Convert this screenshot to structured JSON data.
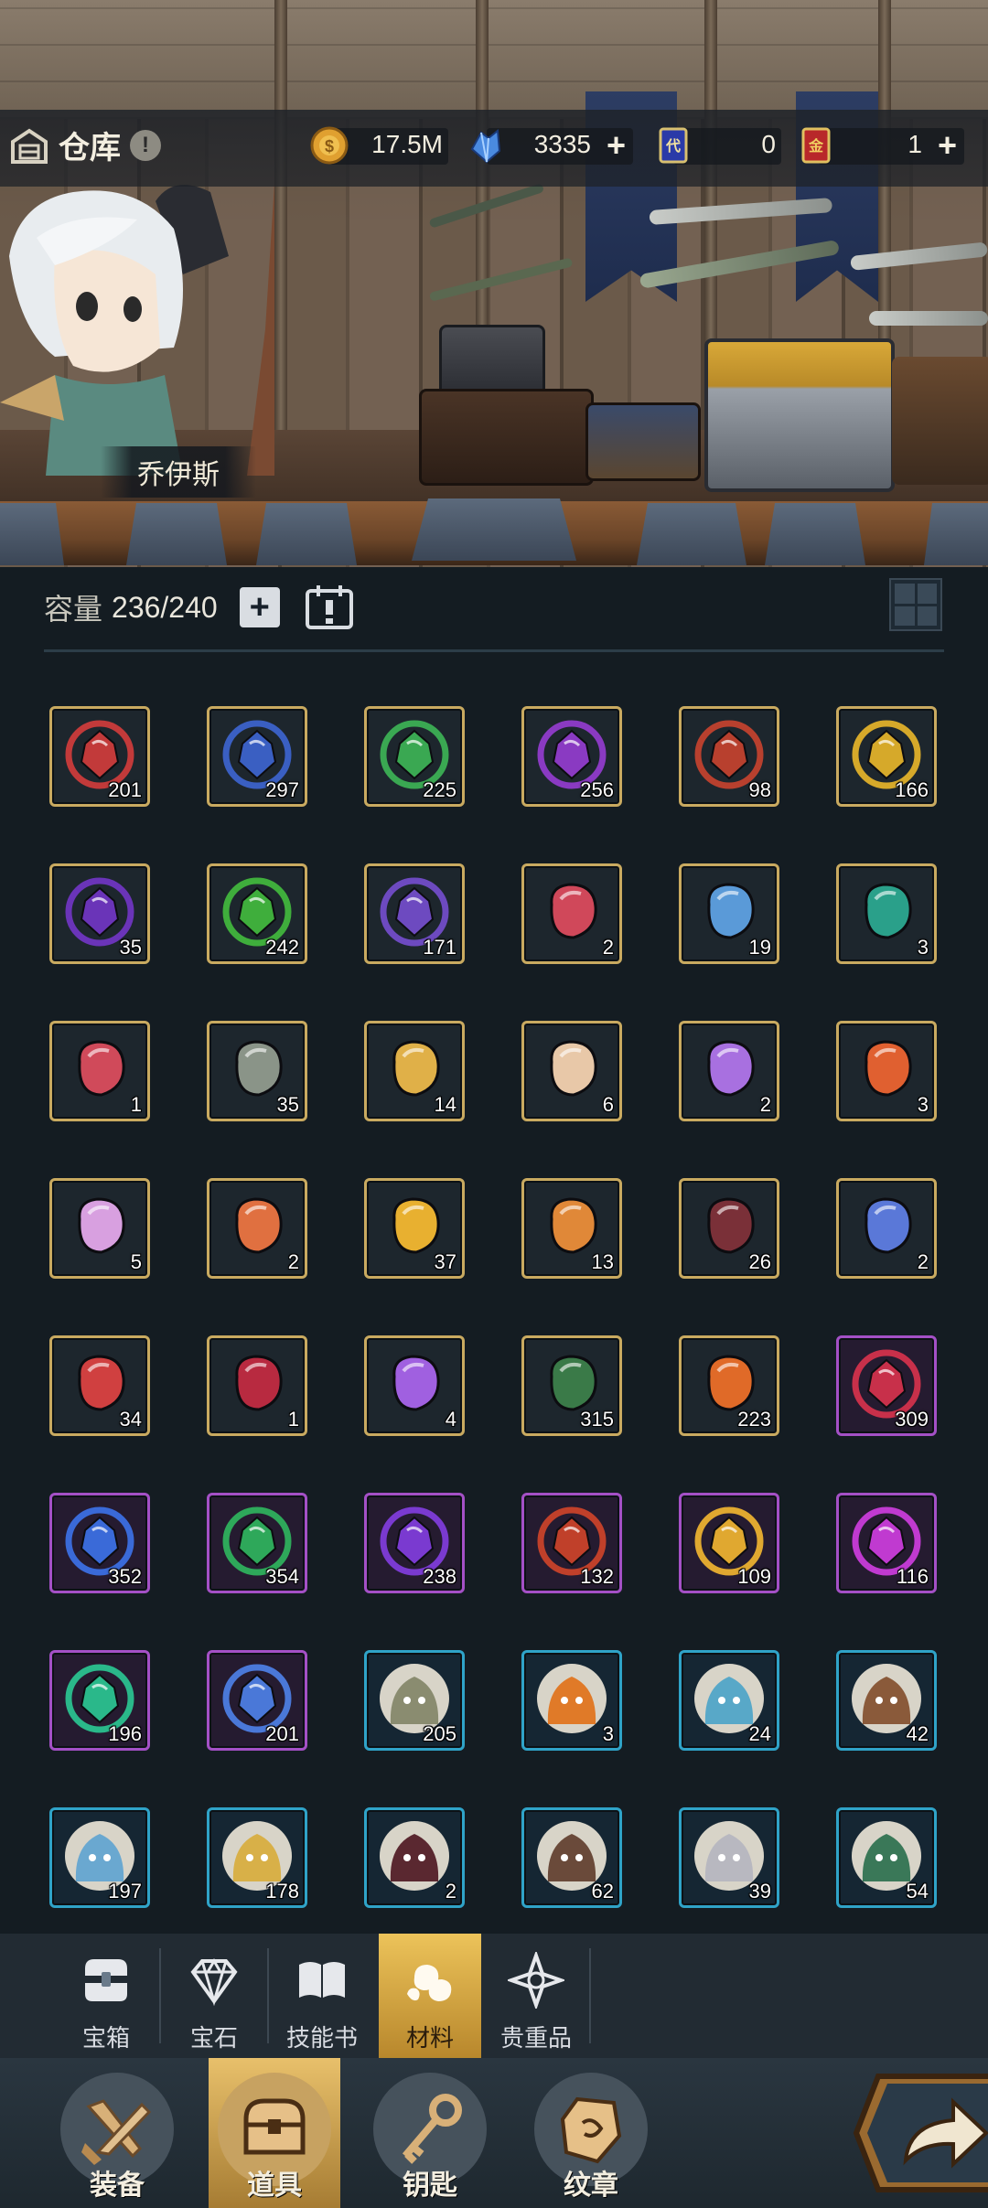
{
  "header": {
    "title": "仓库",
    "info_badge": "!",
    "resources": [
      {
        "name": "gold",
        "icon": "gold-coin-icon",
        "value": "17.5M",
        "has_plus": false
      },
      {
        "name": "crystal",
        "icon": "blue-crystal-icon",
        "value": "3335",
        "has_plus": true
      },
      {
        "name": "blue-ticket",
        "icon": "blue-card-icon",
        "value": "0",
        "has_plus": false
      },
      {
        "name": "gold-ticket",
        "icon": "red-gold-card-icon",
        "value": "1",
        "has_plus": true
      }
    ],
    "plus_label": "+"
  },
  "hero": {
    "name": "乔伊斯"
  },
  "capacity": {
    "label": "容量",
    "value": "236/240",
    "plus_label": "+"
  },
  "items": [
    {
      "icon": "red-fist-emblem-icon",
      "count": "201",
      "rarity": "gold",
      "color": "#c23a3a"
    },
    {
      "icon": "blue-shield-emblem-icon",
      "count": "297",
      "rarity": "gold",
      "color": "#3a5fc2"
    },
    {
      "icon": "green-sprout-emblem-icon",
      "count": "225",
      "rarity": "gold",
      "color": "#3aa852"
    },
    {
      "icon": "purple-eye-emblem-icon",
      "count": "256",
      "rarity": "gold",
      "color": "#8a3ac2"
    },
    {
      "icon": "red-tower-emblem-icon",
      "count": "98",
      "rarity": "gold",
      "color": "#b8402e"
    },
    {
      "icon": "gold-star-emblem-icon",
      "count": "166",
      "rarity": "gold",
      "color": "#d6a92a"
    },
    {
      "icon": "purple-crescent-emblem-icon",
      "count": "35",
      "rarity": "gold",
      "color": "#6a34b8"
    },
    {
      "icon": "green-gem-emblem-icon",
      "count": "242",
      "rarity": "gold",
      "color": "#3fae3c"
    },
    {
      "icon": "purple-swirl-emblem-icon",
      "count": "171",
      "rarity": "gold",
      "color": "#6d4ac0"
    },
    {
      "icon": "red-crystal-flower-icon",
      "count": "2",
      "rarity": "gold",
      "color": "#d0485a"
    },
    {
      "icon": "blue-heart-star-icon",
      "count": "19",
      "rarity": "gold",
      "color": "#5a9ad8"
    },
    {
      "icon": "teal-orb-icon",
      "count": "3",
      "rarity": "gold",
      "color": "#2aa08a"
    },
    {
      "icon": "red-demon-mask-icon",
      "count": "1",
      "rarity": "gold",
      "color": "#d04a5a"
    },
    {
      "icon": "grey-mouse-icon",
      "count": "35",
      "rarity": "gold",
      "color": "#8a9488"
    },
    {
      "icon": "gold-heart-wing-icon",
      "count": "14",
      "rarity": "gold",
      "color": "#e0b048"
    },
    {
      "icon": "cream-heart-crystal-icon",
      "count": "6",
      "rarity": "gold",
      "color": "#e8c8a8"
    },
    {
      "icon": "purple-heart-crystal-icon",
      "count": "2",
      "rarity": "gold",
      "color": "#a870e0"
    },
    {
      "icon": "fire-egg-icon",
      "count": "3",
      "rarity": "gold",
      "color": "#e06030"
    },
    {
      "icon": "pink-heart-icon",
      "count": "5",
      "rarity": "gold",
      "color": "#d8a0e0"
    },
    {
      "icon": "fire-rock-icon",
      "count": "2",
      "rarity": "gold",
      "color": "#e07040"
    },
    {
      "icon": "gold-spike-icon",
      "count": "37",
      "rarity": "gold",
      "color": "#e8b030"
    },
    {
      "icon": "orange-swirl-icon",
      "count": "13",
      "rarity": "gold",
      "color": "#e08838"
    },
    {
      "icon": "green-leaf-scroll-icon",
      "count": "26",
      "rarity": "gold",
      "color": "#7a3038"
    },
    {
      "icon": "blue-ice-crystal-icon",
      "count": "2",
      "rarity": "gold",
      "color": "#5a78d8"
    },
    {
      "icon": "red-claw-icon",
      "count": "34",
      "rarity": "gold",
      "color": "#d04040"
    },
    {
      "icon": "crimson-horn-orb-icon",
      "count": "1",
      "rarity": "gold",
      "color": "#b82a40"
    },
    {
      "icon": "purple-x-bell-icon",
      "count": "4",
      "rarity": "gold",
      "color": "#a060e0"
    },
    {
      "icon": "green-thorn-icon",
      "count": "315",
      "rarity": "gold",
      "color": "#3a7a48"
    },
    {
      "icon": "fire-flame-icon",
      "count": "223",
      "rarity": "gold",
      "color": "#e06a28"
    },
    {
      "icon": "red-fist-emblem-icon",
      "count": "309",
      "rarity": "purple",
      "color": "#c8304a"
    },
    {
      "icon": "blue-shield-emblem-icon",
      "count": "352",
      "rarity": "purple",
      "color": "#3a6ad8"
    },
    {
      "icon": "green-sprout-emblem-icon",
      "count": "354",
      "rarity": "purple",
      "color": "#2ea85a"
    },
    {
      "icon": "purple-eye-emblem-icon",
      "count": "238",
      "rarity": "purple",
      "color": "#7a3ad0"
    },
    {
      "icon": "red-tower-emblem-icon",
      "count": "132",
      "rarity": "purple",
      "color": "#c0402a"
    },
    {
      "icon": "gold-star-emblem-icon",
      "count": "109",
      "rarity": "purple",
      "color": "#e0a830"
    },
    {
      "icon": "magenta-crescent-emblem-icon",
      "count": "116",
      "rarity": "purple",
      "color": "#c03ad0"
    },
    {
      "icon": "teal-gem-emblem-icon",
      "count": "196",
      "rarity": "purple",
      "color": "#2ab88a"
    },
    {
      "icon": "blue-swirl-emblem-icon",
      "count": "201",
      "rarity": "purple",
      "color": "#4a78d8"
    },
    {
      "icon": "hooded-monster-portrait-icon",
      "count": "205",
      "rarity": "blue",
      "color": "#8a8c70"
    },
    {
      "icon": "fire-skull-portrait-icon",
      "count": "3",
      "rarity": "blue",
      "color": "#e07a28"
    },
    {
      "icon": "ice-warrior-portrait-icon",
      "count": "24",
      "rarity": "blue",
      "color": "#58a8c8"
    },
    {
      "icon": "werewolf-portrait-icon",
      "count": "42",
      "rarity": "blue",
      "color": "#8a5a3a"
    },
    {
      "icon": "water-spirit-portrait-icon",
      "count": "197",
      "rarity": "blue",
      "color": "#6aa8d0"
    },
    {
      "icon": "golden-king-portrait-icon",
      "count": "178",
      "rarity": "blue",
      "color": "#d8b048"
    },
    {
      "icon": "dark-dragon-portrait-icon",
      "count": "2",
      "rarity": "blue",
      "color": "#5a2830"
    },
    {
      "icon": "tree-spirit-portrait-icon",
      "count": "62",
      "rarity": "blue",
      "color": "#6a4a3a"
    },
    {
      "icon": "white-wolf-portrait-icon",
      "count": "39",
      "rarity": "blue",
      "color": "#b8b8c0"
    },
    {
      "icon": "green-medusa-portrait-icon",
      "count": "54",
      "rarity": "blue",
      "color": "#3a7858"
    }
  ],
  "categories": [
    {
      "label": "宝箱",
      "icon": "chest-icon",
      "active": false
    },
    {
      "label": "宝石",
      "icon": "gem-icon",
      "active": false
    },
    {
      "label": "技能书",
      "icon": "book-icon",
      "active": false
    },
    {
      "label": "材料",
      "icon": "materials-icon",
      "active": true
    },
    {
      "label": "贵重品",
      "icon": "valuables-star-icon",
      "active": false
    }
  ],
  "bottom_nav": [
    {
      "label": "装备",
      "icon": "crossed-weapons-icon",
      "active": false
    },
    {
      "label": "道具",
      "icon": "treasure-chest-icon",
      "active": true
    },
    {
      "label": "钥匙",
      "icon": "key-icon",
      "active": false
    },
    {
      "label": "纹章",
      "icon": "emblem-stone-icon",
      "active": false
    }
  ],
  "go_button": {
    "icon": "share-arrow-icon"
  },
  "colors": {
    "gold_frame": "#c9aa60",
    "purple_frame": "#a450c6",
    "blue_frame": "#2fa3c8",
    "background": "#141c22",
    "active_tab": "#ecc35a"
  }
}
